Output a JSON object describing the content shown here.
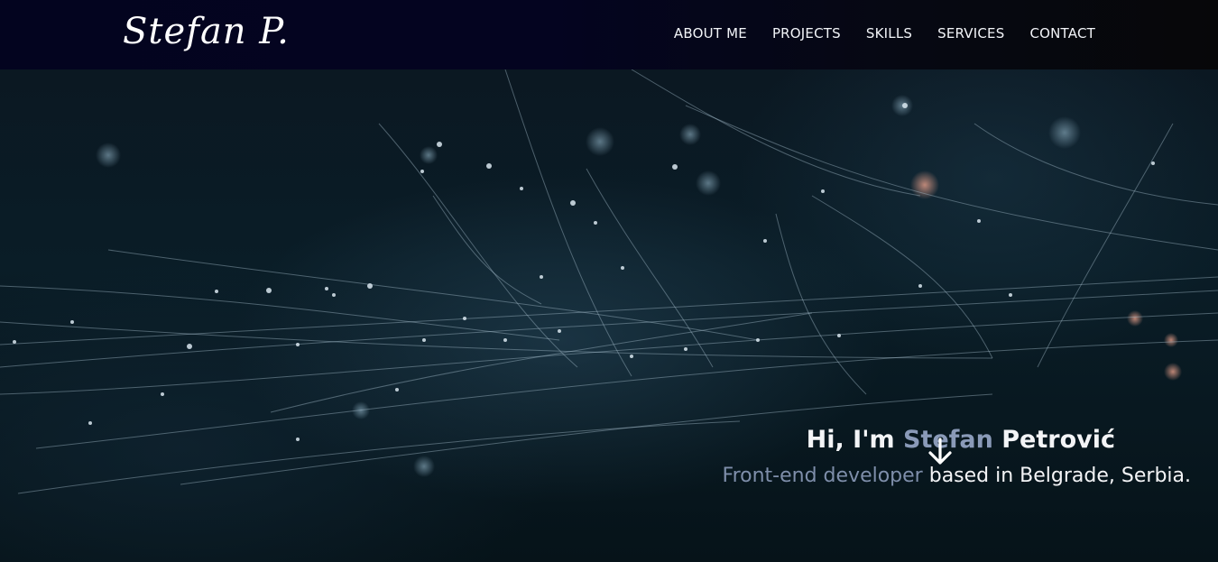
{
  "header": {
    "logo": "Stefan P.",
    "nav": [
      {
        "label": "ABOUT ME"
      },
      {
        "label": "PROJECTS"
      },
      {
        "label": "SKILLS"
      },
      {
        "label": "SERVICES"
      },
      {
        "label": "CONTACT"
      }
    ]
  },
  "hero": {
    "greeting_prefix": "Hi, I'm ",
    "first_name": "Stefan",
    "last_name": " Petrović",
    "role": "Front-end developer",
    "location_text": " based in Belgrade, Serbia.",
    "scroll_icon": "arrow-down-icon"
  },
  "colors": {
    "header_bg": "#03041f",
    "accent_text": "#8a9ab8",
    "text": "#f3f4f6"
  }
}
